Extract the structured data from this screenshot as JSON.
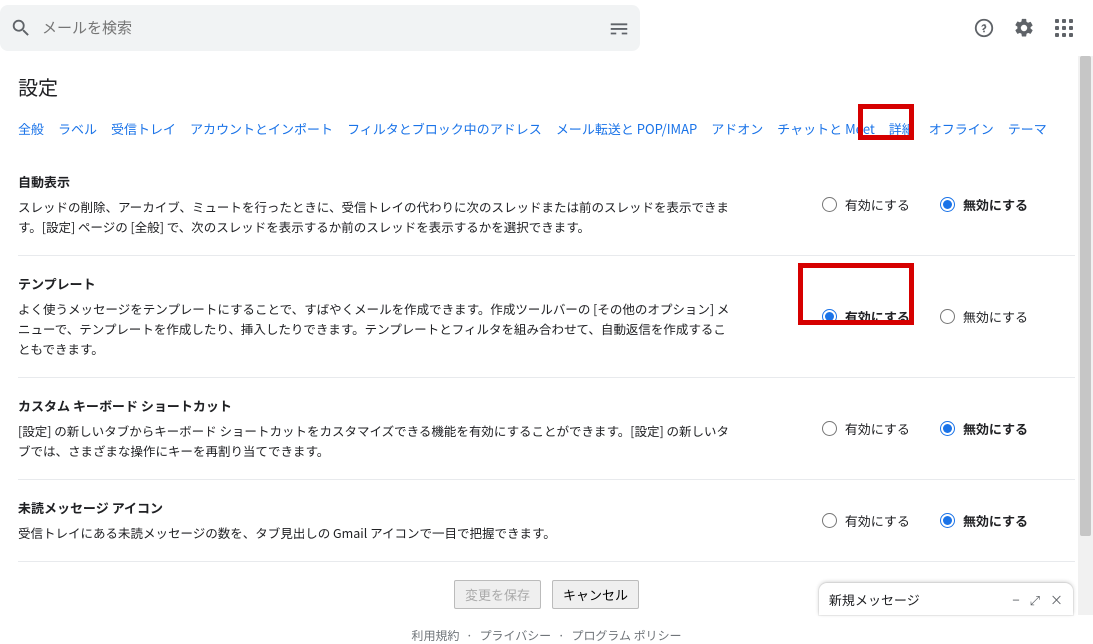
{
  "search": {
    "placeholder": "メールを検索"
  },
  "page_title": "設定",
  "tabs": [
    "全般",
    "ラベル",
    "受信トレイ",
    "アカウントとインポート",
    "フィルタとブロック中のアドレス",
    "メール転送と POP/IMAP",
    "アドオン",
    "チャットと Meet",
    "詳細",
    "オフライン",
    "テーマ"
  ],
  "sections": [
    {
      "heading": "自動表示",
      "body": "スレッドの削除、アーカイブ、ミュートを行ったときに、受信トレイの代わりに次のスレッドまたは前のスレッドを表示できます。[設定] ページの [全般] で、次のスレッドを表示するか前のスレッドを表示するかを選択できます。",
      "enable": "有効にする",
      "disable": "無効にする",
      "value": "disable"
    },
    {
      "heading": "テンプレート",
      "body": "よく使うメッセージをテンプレートにすることで、すばやくメールを作成できます。作成ツールバーの [その他のオプション] メニューで、テンプレートを作成したり、挿入したりできます。テンプレートとフィルタを組み合わせて、自動返信を作成することもできます。",
      "enable": "有効にする",
      "disable": "無効にする",
      "value": "enable"
    },
    {
      "heading": "カスタム キーボード ショートカット",
      "body": "[設定] の新しいタブからキーボード ショートカットをカスタマイズできる機能を有効にすることができます。[設定] の新しいタブでは、さまざまな操作にキーを再割り当てできます。",
      "enable": "有効にする",
      "disable": "無効にする",
      "value": "disable"
    },
    {
      "heading": "未読メッセージ アイコン",
      "body": "受信トレイにある未読メッセージの数を、タブ見出しの Gmail アイコンで一目で把握できます。",
      "enable": "有効にする",
      "disable": "無効にする",
      "value": "disable"
    }
  ],
  "buttons": {
    "save": "変更を保存",
    "cancel": "キャンセル"
  },
  "legal": {
    "terms": "利用規約",
    "privacy": "プライバシー",
    "policy": "プログラム ポリシー",
    "sep": " · "
  },
  "compose": {
    "title": "新規メッセージ"
  }
}
